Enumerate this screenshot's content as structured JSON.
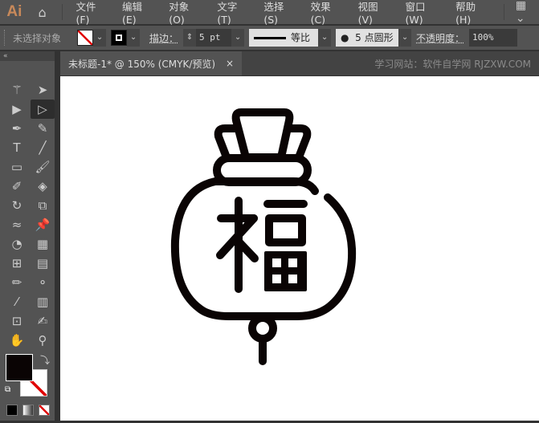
{
  "app": {
    "logo": "Ai",
    "home": "home-icon"
  },
  "menu": [
    "文件(F)",
    "编辑(E)",
    "对象(O)",
    "文字(T)",
    "选择(S)",
    "效果(C)",
    "视图(V)",
    "窗口(W)",
    "帮助(H)"
  ],
  "control": {
    "selection": "未选择对象",
    "stroke_label": "描边：",
    "stroke_value": "5 pt",
    "profile": "等比",
    "brush": "5 点圆形",
    "opacity_label": "不透明度：",
    "opacity_value": "100%"
  },
  "document": {
    "tab_title": "未标题-1* @ 150% (CMYK/预览)",
    "close": "×",
    "watermark": "学习网站：软件自学网 RJZXW.COM"
  },
  "tools": [
    {
      "name": "magic-wand",
      "glyph": "⚚"
    },
    {
      "name": "group-select",
      "glyph": "➤"
    },
    {
      "name": "selection",
      "glyph": "▶"
    },
    {
      "name": "direct-selection",
      "glyph": "▷"
    },
    {
      "name": "pen",
      "glyph": "✒"
    },
    {
      "name": "curvature",
      "glyph": "✎"
    },
    {
      "name": "type",
      "glyph": "T"
    },
    {
      "name": "line",
      "glyph": "╱"
    },
    {
      "name": "rectangle",
      "glyph": "▭"
    },
    {
      "name": "paintbrush",
      "glyph": "🖌"
    },
    {
      "name": "shaper",
      "glyph": "✐"
    },
    {
      "name": "eraser",
      "glyph": "◈"
    },
    {
      "name": "rotate",
      "glyph": "↻"
    },
    {
      "name": "scale",
      "glyph": "⧉"
    },
    {
      "name": "warp",
      "glyph": "≈"
    },
    {
      "name": "puppet-warp",
      "glyph": "📌"
    },
    {
      "name": "shape-builder",
      "glyph": "◔"
    },
    {
      "name": "perspective-grid",
      "glyph": "▦"
    },
    {
      "name": "mesh",
      "glyph": "⊞"
    },
    {
      "name": "gradient",
      "glyph": "▤"
    },
    {
      "name": "eyedropper-measure",
      "glyph": "✏"
    },
    {
      "name": "blend",
      "glyph": "⚬"
    },
    {
      "name": "eyedropper",
      "glyph": "⁄"
    },
    {
      "name": "graph",
      "glyph": "▥"
    },
    {
      "name": "artboard",
      "glyph": "⊡"
    },
    {
      "name": "slice",
      "glyph": "✍"
    },
    {
      "name": "hand",
      "glyph": "✋"
    },
    {
      "name": "zoom",
      "glyph": "⚲"
    }
  ],
  "colors": {
    "fill": "#0a0404",
    "stroke": "none",
    "accent": "#e00000"
  }
}
